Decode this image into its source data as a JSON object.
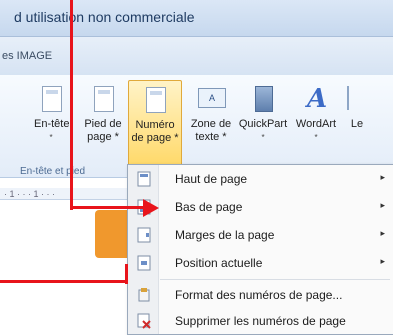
{
  "window": {
    "title": "d utilisation non commerciale"
  },
  "tabs": {
    "current_label": "es IMAGE"
  },
  "ribbon": {
    "buttons": [
      {
        "id": "en-tete",
        "label1": "En-tête",
        "label2": "*",
        "icon": "header-icon"
      },
      {
        "id": "pied",
        "label1": "Pied de",
        "label2": "page *",
        "icon": "footer-icon"
      },
      {
        "id": "numero",
        "label1": "Numéro",
        "label2": "de page *",
        "icon": "page-number-icon"
      },
      {
        "id": "zone-texte",
        "label1": "Zone de",
        "label2": "texte *",
        "icon": "textbox-icon"
      },
      {
        "id": "quickpart",
        "label1": "QuickPart",
        "label2": "*",
        "icon": "quickparts-icon"
      },
      {
        "id": "wordart",
        "label1": "WordArt",
        "label2": "*",
        "icon": "wordart-icon"
      },
      {
        "id": "lettrine",
        "label1": "Le",
        "label2": "",
        "icon": "dropcap-icon"
      }
    ],
    "group_label": "En-tête et pied"
  },
  "menu": {
    "items": [
      {
        "label": "Haut de page",
        "submenu": "▸",
        "icon": "page-top-icon"
      },
      {
        "label": "Bas de page",
        "submenu": "▸",
        "icon": "page-bottom-icon"
      },
      {
        "label": "Marges de la page",
        "submenu": "▸",
        "icon": "page-margins-icon"
      },
      {
        "label": "Position actuelle",
        "submenu": "▸",
        "icon": "current-position-icon"
      },
      {
        "label": "Format des numéros de page...",
        "submenu": "",
        "icon": "format-numbers-icon"
      },
      {
        "label": "Supprimer les numéros de page",
        "submenu": "",
        "icon": "remove-numbers-icon"
      }
    ]
  },
  "colors": {
    "annotation": "#e8141b",
    "highlight": "#ffd96a"
  }
}
